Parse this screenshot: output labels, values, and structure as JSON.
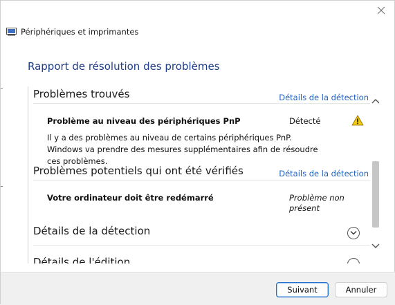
{
  "window": {
    "title": "Périphériques et imprimantes"
  },
  "heading": "Rapport de résolution des problèmes",
  "sections": {
    "found": {
      "title": "Problèmes trouvés",
      "link": "Détails de la détection",
      "item_label": "Problème au niveau des périphériques PnP",
      "item_status": "Détecté",
      "item_desc": "Il y a des problèmes au niveau de certains périphériques PnP. Windows va prendre des mesures supplémentaires afin de résoudre ces problèmes."
    },
    "checked": {
      "title": "Problèmes potentiels qui ont été vérifiés",
      "link": "Détails de la détection",
      "item_label": "Votre ordinateur doit être redémarré",
      "item_status_line1": "Problème non",
      "item_status_line2": "présent"
    },
    "detection": {
      "title": "Détails de la détection"
    },
    "cut": {
      "title": "Détails de l'édition"
    }
  },
  "buttons": {
    "next": "Suivant",
    "cancel": "Annuler"
  },
  "icons": {
    "close": "close-icon",
    "app": "devices-printers-icon",
    "warning": "warning-icon",
    "expand": "chevron-down-icon",
    "scroll_up": "chevron-up-icon",
    "scroll_down": "chevron-down-icon"
  },
  "colors": {
    "heading": "#1e3e8a",
    "link": "#1f5fbf",
    "warning": "#f2c811",
    "primary_border": "#1f6fd0"
  }
}
